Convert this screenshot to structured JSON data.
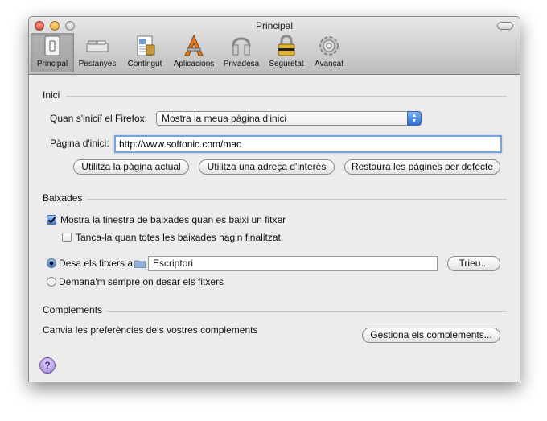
{
  "window": {
    "title": "Principal"
  },
  "toolbar": {
    "items": [
      {
        "label": "Principal",
        "icon": "switch-icon",
        "active": true
      },
      {
        "label": "Pestanyes",
        "icon": "tabs-icon",
        "active": false
      },
      {
        "label": "Contingut",
        "icon": "content-icon",
        "active": false
      },
      {
        "label": "Aplicacions",
        "icon": "applications-icon",
        "active": false
      },
      {
        "label": "Privadesa",
        "icon": "privacy-icon",
        "active": false
      },
      {
        "label": "Seguretat",
        "icon": "lock-icon",
        "active": false
      },
      {
        "label": "Avançat",
        "icon": "gear-icon",
        "active": false
      }
    ]
  },
  "inici": {
    "title": "Inici",
    "startup_label": "Quan s'iniciï el Firefox:",
    "startup_value": "Mostra la meua pàgina d'inici",
    "homepage_label": "Pàgina d'inici:",
    "homepage_value": "http://www.softonic.com/mac",
    "btn_current": "Utilitza la pàgina actual",
    "btn_bookmark": "Utilitza una adreça d'interès",
    "btn_restore": "Restaura les pàgines per defecte"
  },
  "baixades": {
    "title": "Baixades",
    "show_window_label": "Mostra la finestra de baixades quan es baixi un fitxer",
    "show_window_checked": true,
    "close_when_done_label": "Tanca-la quan totes les baixades hagin finalitzat",
    "close_when_done_checked": false,
    "save_to_label": "Desa els fitxers a",
    "save_to_folder": "Escriptori",
    "save_to_checked": true,
    "choose_button": "Trieu...",
    "always_ask_label": "Demana'm sempre on desar els fitxers",
    "always_ask_checked": false
  },
  "complements": {
    "title": "Complements",
    "description": "Canvia les preferències dels vostres complements",
    "manage_button": "Gestiona els complements..."
  },
  "help": {
    "glyph": "?"
  }
}
